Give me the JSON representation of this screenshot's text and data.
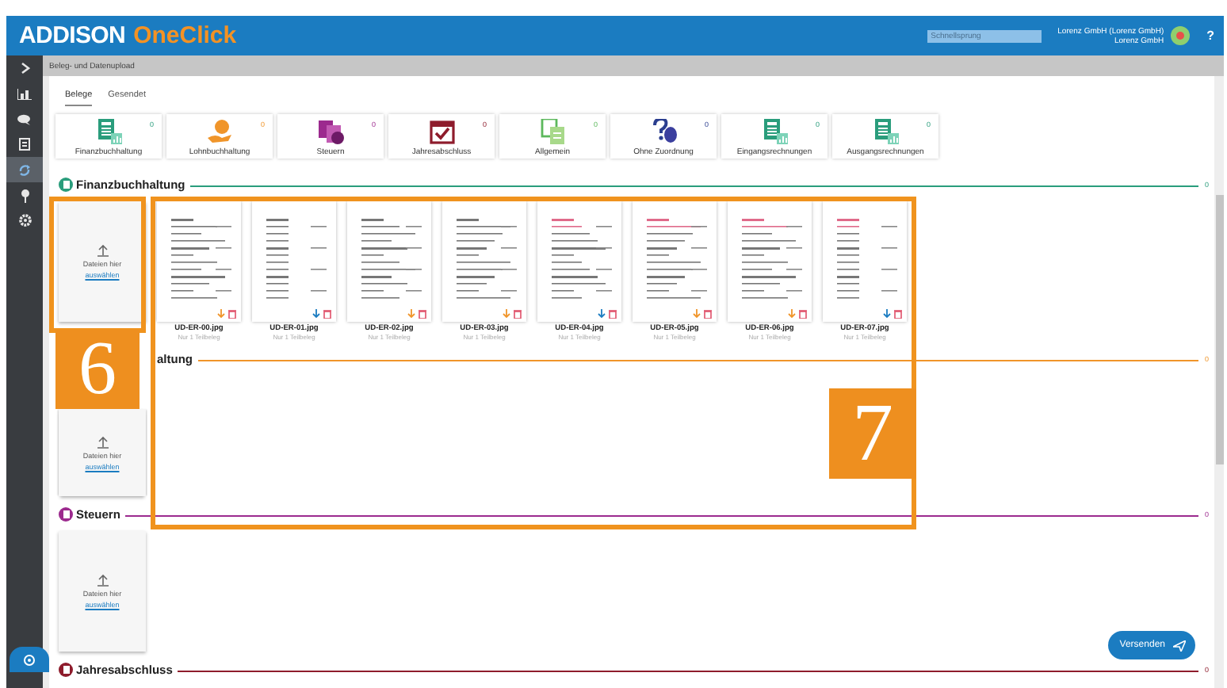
{
  "header": {
    "logo_main": "ADDISON",
    "logo_accent": "OneClick",
    "search": {
      "placeholder": "Schnellsprung"
    },
    "user_line_1": "Lorenz GmbH (Lorenz GmbH)",
    "user_line_2": "Lorenz GmbH",
    "help": "?"
  },
  "breadcrumb": "Beleg- und Datenupload",
  "sidebar": {
    "items": [
      {
        "selected": false
      },
      {
        "selected": false
      },
      {
        "selected": false
      },
      {
        "selected": false
      },
      {
        "selected": true
      },
      {
        "selected": false
      },
      {
        "selected": false
      }
    ]
  },
  "tabs": [
    {
      "label": "Belege",
      "selected": true
    },
    {
      "label": "Gesendet",
      "selected": false
    }
  ],
  "categories": [
    {
      "label": "Finanzbuchhaltung",
      "count": "0"
    },
    {
      "label": "Lohnbuchhaltung",
      "count": "0"
    },
    {
      "label": "Steuern",
      "count": "0"
    },
    {
      "label": "Jahresabschluss",
      "count": "0"
    },
    {
      "label": "Allgemein",
      "count": "0"
    },
    {
      "label": "Ohne Zuordnung",
      "count": "0"
    },
    {
      "label": "Eingangsrechnungen",
      "count": "0"
    },
    {
      "label": "Ausgangsrechnungen",
      "count": "0"
    }
  ],
  "sections": [
    {
      "title": "Finanzbuchhaltung",
      "count": "0",
      "color": "#2a9d7c",
      "icon_visible": true,
      "upload": {
        "text": "Dateien hier",
        "link": "auswählen"
      },
      "documents": [
        {
          "filename": "UD-ER-00.jpg",
          "note": "Nur 1 Teilbeleg"
        },
        {
          "filename": "UD-ER-01.jpg",
          "note": "Nur 1 Teilbeleg"
        },
        {
          "filename": "UD-ER-02.jpg",
          "note": "Nur 1 Teilbeleg"
        },
        {
          "filename": "UD-ER-03.jpg",
          "note": "Nur 1 Teilbeleg"
        },
        {
          "filename": "UD-ER-04.jpg",
          "note": "Nur 1 Teilbeleg"
        },
        {
          "filename": "UD-ER-05.jpg",
          "note": "Nur 1 Teilbeleg"
        },
        {
          "filename": "UD-ER-06.jpg",
          "note": "Nur 1 Teilbeleg"
        },
        {
          "filename": "UD-ER-07.jpg",
          "note": "Nur 1 Teilbeleg"
        }
      ]
    },
    {
      "title": "altung",
      "count": "0",
      "color": "#f0952a",
      "icon_visible": false,
      "upload": {
        "text": "Dateien hier",
        "link": "auswählen"
      }
    },
    {
      "title": "Steuern",
      "count": "0",
      "color": "#9c2a8e",
      "icon_visible": true,
      "upload": {
        "text": "Dateien hier",
        "link": "auswählen"
      }
    },
    {
      "title": "Jahresabschluss",
      "count": "0",
      "color": "#8e1c2c",
      "icon_visible": true
    }
  ],
  "send_button": "Versenden",
  "annotations": [
    {
      "label": "6"
    },
    {
      "label": "7"
    }
  ]
}
